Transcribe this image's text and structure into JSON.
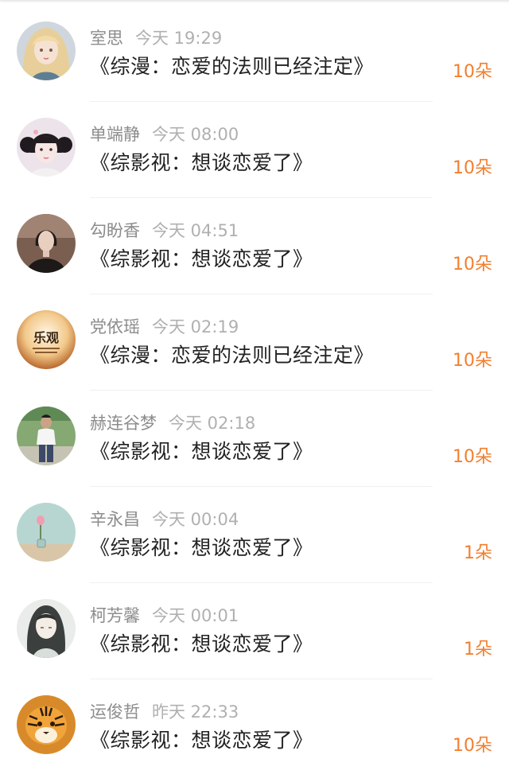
{
  "colors": {
    "accent": "#f27f2f",
    "name": "#8c8c8c",
    "time": "#b0b0b0",
    "title": "#222222"
  },
  "records": [
    {
      "name": "室思",
      "time": "今天 19:29",
      "book": "《综漫：恋爱的法则已经注定》",
      "amount": "10朵",
      "avatar": "blonde-girl-avatar"
    },
    {
      "name": "单端静",
      "time": "今天 08:00",
      "book": "《综影视：想谈恋爱了》",
      "amount": "10朵",
      "avatar": "pigtail-girl-avatar"
    },
    {
      "name": "勾盼香",
      "time": "今天 04:51",
      "book": "《综影视：想谈恋爱了》",
      "amount": "10朵",
      "avatar": "dark-portrait-avatar"
    },
    {
      "name": "党依瑶",
      "time": "今天 02:19",
      "book": "《综漫：恋爱的法则已经注定》",
      "amount": "10朵",
      "avatar": "leguan-text-avatar",
      "avatar_text": "乐观"
    },
    {
      "name": "赫连谷梦",
      "time": "今天 02:18",
      "book": "《综影视：想谈恋爱了》",
      "amount": "10朵",
      "avatar": "standing-man-avatar"
    },
    {
      "name": "辛永昌",
      "time": "今天 00:04",
      "book": "《综影视：想谈恋爱了》",
      "amount": "1朵",
      "avatar": "flower-vase-avatar"
    },
    {
      "name": "柯芳馨",
      "time": "今天 00:01",
      "book": "《综影视：想谈恋爱了》",
      "amount": "1朵",
      "avatar": "ink-drawing-avatar"
    },
    {
      "name": "运俊哲",
      "time": "昨天 22:33",
      "book": "《综影视：想谈恋爱了》",
      "amount": "10朵",
      "avatar": "tiger-avatar"
    }
  ]
}
